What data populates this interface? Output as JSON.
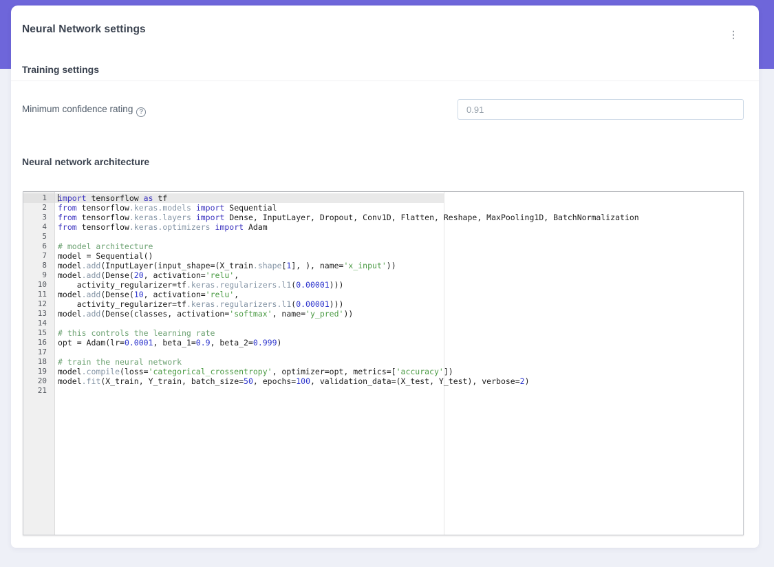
{
  "card": {
    "title": "Neural Network settings",
    "menu_icon": "⋮"
  },
  "training": {
    "heading": "Training settings",
    "confidence": {
      "label": "Minimum confidence rating",
      "help_icon": "?",
      "value": "0.91"
    }
  },
  "architecture": {
    "heading": "Neural network architecture"
  },
  "colors": {
    "accent_purple": "#6e66da",
    "page_bg": "#eef0f7",
    "heading": "#3b4350",
    "input_border": "#cbd8e6",
    "input_text": "#98a2ac",
    "gutter_bg": "#f0f0f0",
    "active_line": "#e9e9e9",
    "tok_keyword": "#3b33bf",
    "tok_property": "#8494a5",
    "tok_number": "#2a32cc",
    "tok_string": "#4a9a43",
    "tok_comment": "#6ba171"
  },
  "editor": {
    "lines": [
      {
        "num": 1,
        "active": true,
        "cursor": true,
        "tokens": [
          [
            "k",
            "import"
          ],
          [
            "t",
            " tensorflow "
          ],
          [
            "k",
            "as"
          ],
          [
            "t",
            " tf"
          ]
        ]
      },
      {
        "num": 2,
        "tokens": [
          [
            "k",
            "from"
          ],
          [
            "t",
            " tensorflow"
          ],
          [
            "p",
            ".keras.models"
          ],
          [
            "t",
            " "
          ],
          [
            "k",
            "import"
          ],
          [
            "t",
            " Sequential"
          ]
        ]
      },
      {
        "num": 3,
        "tokens": [
          [
            "k",
            "from"
          ],
          [
            "t",
            " tensorflow"
          ],
          [
            "p",
            ".keras.layers"
          ],
          [
            "t",
            " "
          ],
          [
            "k",
            "import"
          ],
          [
            "t",
            " Dense, InputLayer, Dropout, Conv1D, Flatten, Reshape, MaxPooling1D, BatchNormalization"
          ]
        ]
      },
      {
        "num": 4,
        "tokens": [
          [
            "k",
            "from"
          ],
          [
            "t",
            " tensorflow"
          ],
          [
            "p",
            ".keras.optimizers"
          ],
          [
            "t",
            " "
          ],
          [
            "k",
            "import"
          ],
          [
            "t",
            " Adam"
          ]
        ]
      },
      {
        "num": 5,
        "tokens": []
      },
      {
        "num": 6,
        "tokens": [
          [
            "c",
            "# model architecture"
          ]
        ]
      },
      {
        "num": 7,
        "tokens": [
          [
            "t",
            "model = Sequential()"
          ]
        ]
      },
      {
        "num": 8,
        "tokens": [
          [
            "t",
            "model"
          ],
          [
            "p",
            ".add"
          ],
          [
            "t",
            "(InputLayer(input_shape=(X_train"
          ],
          [
            "p",
            ".shape"
          ],
          [
            "t",
            "["
          ],
          [
            "n",
            "1"
          ],
          [
            "t",
            "], ), name="
          ],
          [
            "s",
            "'x_input'"
          ],
          [
            "t",
            "))"
          ]
        ]
      },
      {
        "num": 9,
        "tokens": [
          [
            "t",
            "model"
          ],
          [
            "p",
            ".add"
          ],
          [
            "t",
            "(Dense("
          ],
          [
            "n",
            "20"
          ],
          [
            "t",
            ", activation="
          ],
          [
            "s",
            "'relu'"
          ],
          [
            "t",
            ","
          ]
        ]
      },
      {
        "num": 10,
        "tokens": [
          [
            "t",
            "    activity_regularizer=tf"
          ],
          [
            "p",
            ".keras.regularizers.l1"
          ],
          [
            "t",
            "("
          ],
          [
            "n",
            "0.00001"
          ],
          [
            "t",
            ")))"
          ]
        ]
      },
      {
        "num": 11,
        "tokens": [
          [
            "t",
            "model"
          ],
          [
            "p",
            ".add"
          ],
          [
            "t",
            "(Dense("
          ],
          [
            "n",
            "10"
          ],
          [
            "t",
            ", activation="
          ],
          [
            "s",
            "'relu'"
          ],
          [
            "t",
            ","
          ]
        ]
      },
      {
        "num": 12,
        "tokens": [
          [
            "t",
            "    activity_regularizer=tf"
          ],
          [
            "p",
            ".keras.regularizers.l1"
          ],
          [
            "t",
            "("
          ],
          [
            "n",
            "0.00001"
          ],
          [
            "t",
            ")))"
          ]
        ]
      },
      {
        "num": 13,
        "tokens": [
          [
            "t",
            "model"
          ],
          [
            "p",
            ".add"
          ],
          [
            "t",
            "(Dense(classes, activation="
          ],
          [
            "s",
            "'softmax'"
          ],
          [
            "t",
            ", name="
          ],
          [
            "s",
            "'y_pred'"
          ],
          [
            "t",
            "))"
          ]
        ]
      },
      {
        "num": 14,
        "tokens": []
      },
      {
        "num": 15,
        "tokens": [
          [
            "c",
            "# this controls the learning rate"
          ]
        ]
      },
      {
        "num": 16,
        "tokens": [
          [
            "t",
            "opt = Adam(lr="
          ],
          [
            "n",
            "0.0001"
          ],
          [
            "t",
            ", beta_1="
          ],
          [
            "n",
            "0.9"
          ],
          [
            "t",
            ", beta_2="
          ],
          [
            "n",
            "0.999"
          ],
          [
            "t",
            ")"
          ]
        ]
      },
      {
        "num": 17,
        "tokens": []
      },
      {
        "num": 18,
        "tokens": [
          [
            "c",
            "# train the neural network"
          ]
        ]
      },
      {
        "num": 19,
        "tokens": [
          [
            "t",
            "model"
          ],
          [
            "p",
            ".compile"
          ],
          [
            "t",
            "(loss="
          ],
          [
            "s",
            "'categorical_crossentropy'"
          ],
          [
            "t",
            ", optimizer=opt, metrics=["
          ],
          [
            "s",
            "'accuracy'"
          ],
          [
            "t",
            "])"
          ]
        ]
      },
      {
        "num": 20,
        "tokens": [
          [
            "t",
            "model"
          ],
          [
            "p",
            ".fit"
          ],
          [
            "t",
            "(X_train, Y_train, batch_size="
          ],
          [
            "n",
            "50"
          ],
          [
            "t",
            ", epochs="
          ],
          [
            "n",
            "100"
          ],
          [
            "t",
            ", validation_data=(X_test, Y_test), verbose="
          ],
          [
            "n",
            "2"
          ],
          [
            "t",
            ")"
          ]
        ]
      },
      {
        "num": 21,
        "tokens": []
      }
    ]
  }
}
